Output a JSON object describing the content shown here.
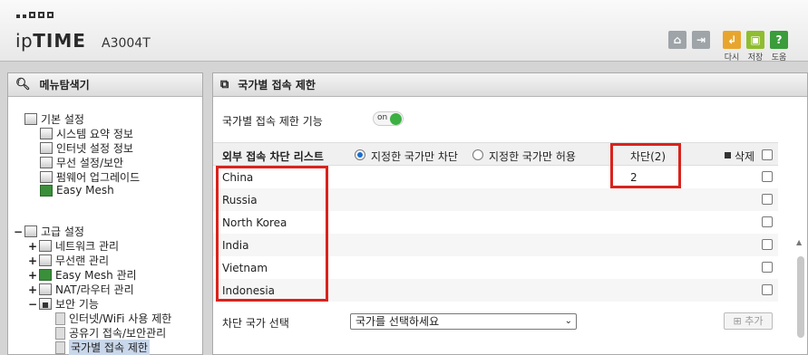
{
  "header": {
    "brand_ip": "ip",
    "brand_time": "TIME",
    "model": "A3004T",
    "buttons": [
      {
        "icon": "home-icon",
        "label": ""
      },
      {
        "icon": "logout-icon",
        "label": ""
      },
      {
        "icon": "advanced-icon",
        "label": "다시"
      },
      {
        "icon": "save-icon",
        "label": "저장"
      },
      {
        "icon": "help-icon",
        "label": "도움"
      }
    ]
  },
  "menu": {
    "title": "메뉴탐색기",
    "basic": {
      "label": "기본 설정",
      "items": [
        "시스템 요약 정보",
        "인터넷 설정 정보",
        "무선 설정/보안",
        "펌웨어 업그레이드",
        "Easy Mesh"
      ]
    },
    "advanced": {
      "label": "고급 설정",
      "items": [
        "네트워크 관리",
        "무선랜 관리",
        "Easy Mesh 관리",
        "NAT/라우터 관리",
        "보안 기능"
      ],
      "security_items": [
        "인터넷/WiFi 사용 제한",
        "공유기 접속/보안관리",
        "국가별 접속 제한"
      ]
    }
  },
  "content": {
    "title": "국가별 접속 제한",
    "feature_label": "국가별 접속 제한 기능",
    "toggle_text": "on",
    "list_label": "외부 접속 차단 리스트",
    "radio_block": "지정한 국가만 차단",
    "radio_allow": "지정한 국가만 허용",
    "block_col": "차단(2)",
    "block_value": "2",
    "delete_col": "삭제",
    "countries": [
      "China",
      "Russia",
      "North Korea",
      "India",
      "Vietnam",
      "Indonesia"
    ],
    "select_label": "차단 국가 선택",
    "select_placeholder": "국가를 선택하세요",
    "add_button": "추가"
  },
  "colors": {
    "highlight": "#d9231d",
    "toggle_on": "#3cb043",
    "radio_on": "#1a6fd0"
  }
}
